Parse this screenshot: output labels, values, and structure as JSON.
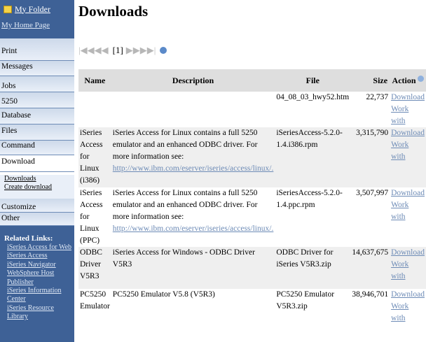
{
  "sidebar": {
    "folder_label": "My Folder",
    "home_label": "My Home Page",
    "nav": [
      "Print",
      "Messages",
      "Jobs",
      "5250",
      "Database",
      "Files",
      "Command",
      "Download"
    ],
    "download_sub": [
      "Downloads",
      "Create download"
    ],
    "nav_after": [
      "Customize",
      "Other"
    ],
    "related_header": "Related Links:",
    "related_links": [
      "iSeries Access for Web",
      "iSeries Access",
      "iSeries Navigator",
      "WebSphere Host",
      "Publisher",
      "iSeries Information",
      "Center",
      "iSeries Resource Library"
    ]
  },
  "main": {
    "title": "Downloads",
    "pager_label": "[1]",
    "headers": {
      "name": "Name",
      "description": "Description",
      "file": "File",
      "size": "Size",
      "action": "Action"
    },
    "rows": [
      {
        "name": "",
        "desc": "",
        "url": "",
        "file": "04_08_03_hwy52.htm",
        "size": "22,737"
      },
      {
        "name": "iSeries Access for Linux (i386)",
        "desc": "iSeries Access for Linux contains a full 5250 emulator and an enhanced ODBC driver. For more information see:",
        "url": "http://www.ibm.com/eserver/iseries/access/linux/.",
        "file": "iSeriesAccess-5.2.0-1.4.i386.rpm",
        "size": "3,315,790"
      },
      {
        "name": "iSeries Access for Linux (PPC)",
        "desc": "iSeries Access for Linux contains a full 5250 emulator and an enhanced ODBC driver. For more information see:",
        "url": "http://www.ibm.com/eserver/iseries/access/linux/.",
        "file": "iSeriesAccess-5.2.0-1.4.ppc.rpm",
        "size": "3,507,997"
      },
      {
        "name": "ODBC Driver V5R3",
        "desc": "iSeries Access for Windows - ODBC Driver V5R3",
        "url": "",
        "file": "ODBC Driver for iSeries V5R3.zip",
        "size": "14,637,675"
      },
      {
        "name": "PC5250 Emulator",
        "desc": "PC5250 Emulator V5.8 (V5R3)",
        "url": "",
        "file": "PC5250 Emulator V5R3.zip",
        "size": "38,946,701"
      }
    ],
    "actions": {
      "download": "Download",
      "work": "Work",
      "with": "with"
    }
  },
  "colors": {
    "sidebar_dark": "#3e6196",
    "link": "#6d8bb6",
    "header_bg": "#dedede",
    "band_bg": "#efefef"
  }
}
